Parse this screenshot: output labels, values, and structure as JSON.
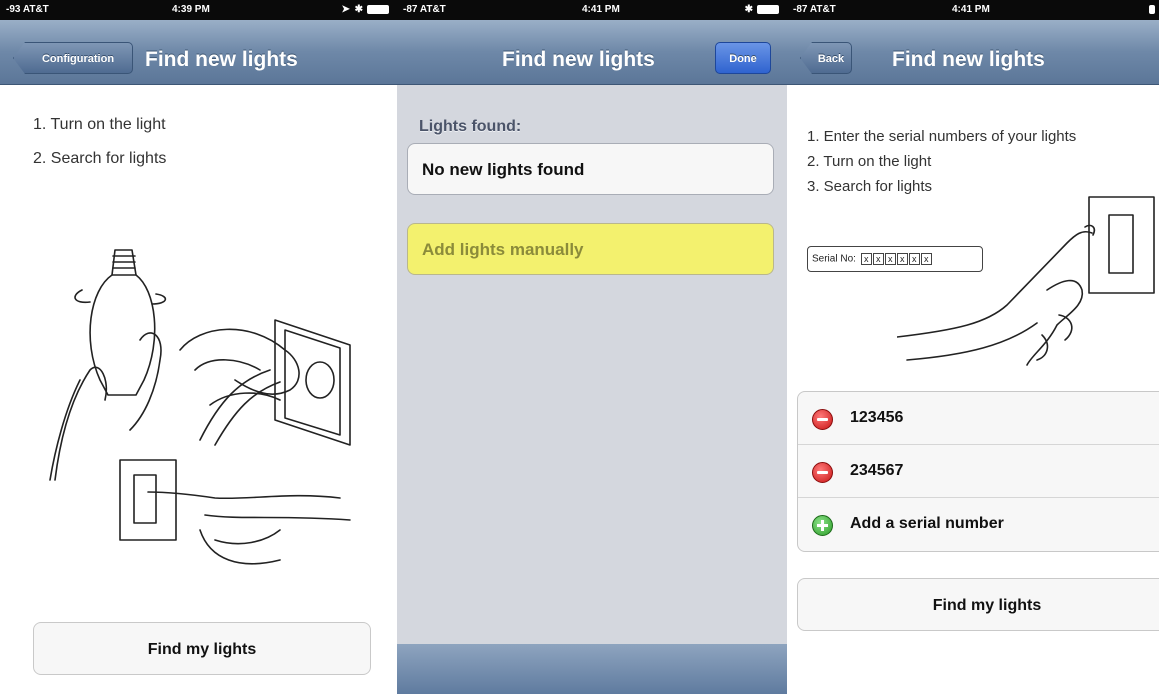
{
  "panels": [
    {
      "status": {
        "carrier": "-93 AT&T",
        "time": "4:39 PM"
      },
      "nav": {
        "back_label": "Configuration",
        "title": "Find new lights"
      },
      "steps": [
        "1. Turn on the light",
        "2. Search for lights"
      ],
      "primary_button": "Find my lights"
    },
    {
      "status": {
        "carrier": "-87 AT&T",
        "time": "4:41 PM"
      },
      "nav": {
        "title": "Find new lights",
        "done_label": "Done"
      },
      "section_label": "Lights found:",
      "no_lights_text": "No new lights found",
      "add_manually_label": "Add lights manually"
    },
    {
      "status": {
        "carrier": "-87 AT&T",
        "time": "4:41 PM"
      },
      "nav": {
        "back_label": "Back",
        "title": "Find new lights"
      },
      "steps": [
        "1. Enter the serial numbers of your lights",
        "2. Turn on the light",
        "3. Search for lights"
      ],
      "serial_illustration": {
        "label": "Serial No",
        "chars": [
          "x",
          "x",
          "x",
          "x",
          "x",
          "x"
        ]
      },
      "serials": [
        "123456",
        "234567"
      ],
      "add_serial_label": "Add a serial number",
      "primary_button": "Find my lights"
    }
  ],
  "colors": {
    "navbar": "#6e88a8",
    "highlight": "#f3f16e",
    "done": "#2f63cf",
    "delete": "#c81414",
    "add": "#2a9b26"
  }
}
